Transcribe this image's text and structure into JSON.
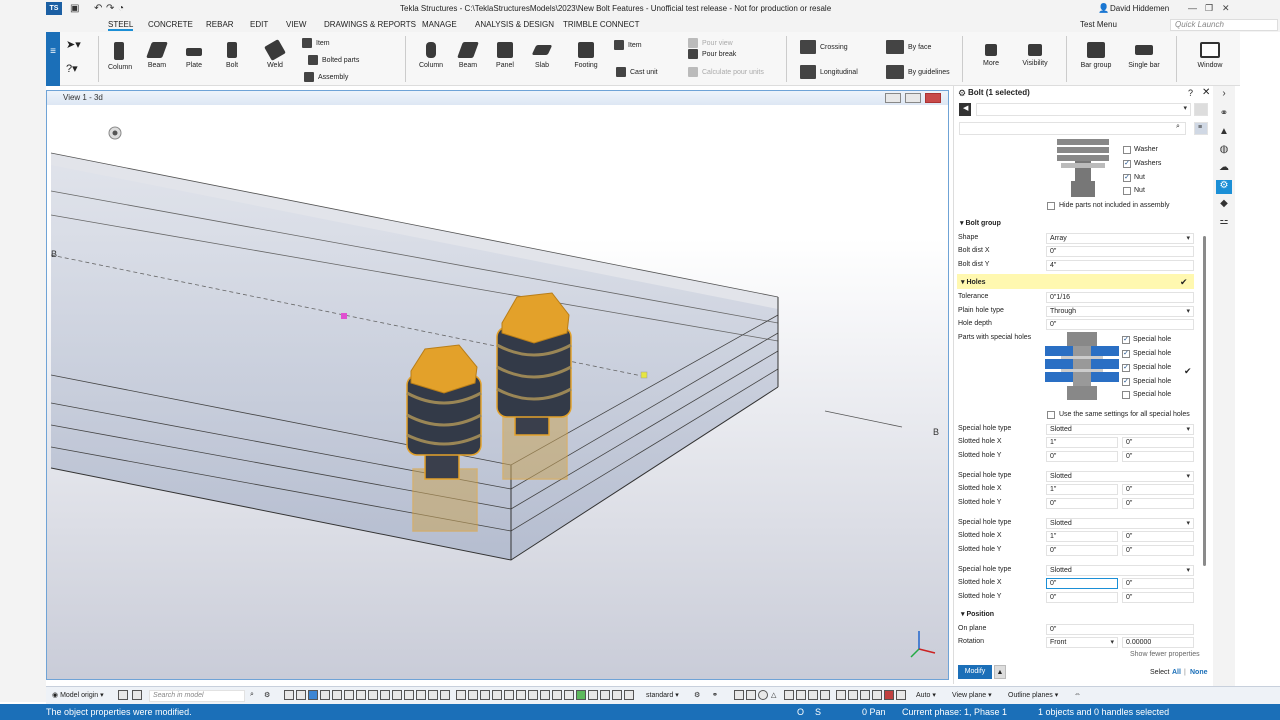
{
  "title_bar": {
    "app_logo": "TS",
    "title": "Tekla Structures - C:\\TeklaStructuresModels\\2023\\New Bolt Features - Unofficial test release - Not for production or resale",
    "user": "David Hiddemen"
  },
  "menu": {
    "tabs": [
      "STEEL",
      "CONCRETE",
      "REBAR",
      "EDIT",
      "VIEW",
      "DRAWINGS & REPORTS",
      "MANAGE",
      "ANALYSIS & DESIGN",
      "TRIMBLE CONNECT"
    ],
    "active": "STEEL",
    "test_menu": "Test Menu",
    "quick_launch_placeholder": "Quick Launch"
  },
  "ribbon": {
    "steel": [
      "Column",
      "Beam",
      "Plate",
      "Bolt",
      "Weld"
    ],
    "steel_small": [
      "Item",
      "Bolted parts",
      "Assembly"
    ],
    "concrete": [
      "Column",
      "Beam",
      "Panel",
      "Slab",
      "Footing"
    ],
    "concrete_small": [
      "Item",
      "Cast unit"
    ],
    "pour": [
      "Pour view",
      "Pour break",
      "Calculate pour units"
    ],
    "rebar": [
      "Crossing",
      "Longitudinal"
    ],
    "rebar_by": [
      "By face",
      "By guidelines"
    ],
    "tools": [
      "More",
      "Visibility"
    ],
    "bar": [
      "Bar group",
      "Single bar"
    ],
    "window": "Window"
  },
  "view": {
    "title": "View 1 - 3d",
    "gridlabel_left": "B",
    "gridlabel_right": "B"
  },
  "panel": {
    "title": "Bolt (1 selected)",
    "assembly_checks": [
      {
        "label": "Washer",
        "checked": false
      },
      {
        "label": "Washers",
        "checked": true
      },
      {
        "label": "Nut",
        "checked": true
      },
      {
        "label": "Nut",
        "checked": false
      }
    ],
    "hide_parts_label": "Hide parts not included in assembly",
    "bolt_group": {
      "header": "Bolt group",
      "shape_label": "Shape",
      "shape": "Array",
      "dist_x_label": "Bolt dist X",
      "dist_x": "0\"",
      "dist_y_label": "Bolt dist Y",
      "dist_y": "4\""
    },
    "holes": {
      "header": "Holes",
      "tolerance_label": "Tolerance",
      "tolerance": "0\"1/16",
      "plain_label": "Plain hole type",
      "plain": "Through",
      "depth_label": "Hole depth",
      "depth": "0\"",
      "parts_label": "Parts with special holes",
      "special": [
        {
          "label": "Special hole",
          "checked": true
        },
        {
          "label": "Special hole",
          "checked": true
        },
        {
          "label": "Special hole",
          "checked": true
        },
        {
          "label": "Special hole",
          "checked": true
        },
        {
          "label": "Special hole",
          "checked": false
        }
      ],
      "same_settings_label": "Use the same settings for all special holes",
      "groups": [
        {
          "type_label": "Special hole type",
          "type": "Slotted",
          "x_label": "Slotted hole X",
          "x1": "1\"",
          "x2": "0\"",
          "y_label": "Slotted hole Y",
          "y1": "0\"",
          "y2": "0\""
        },
        {
          "type_label": "Special hole type",
          "type": "Slotted",
          "x_label": "Slotted hole X",
          "x1": "1\"",
          "x2": "0\"",
          "y_label": "Slotted hole Y",
          "y1": "0\"",
          "y2": "0\""
        },
        {
          "type_label": "Special hole type",
          "type": "Slotted",
          "x_label": "Slotted hole X",
          "x1": "1\"",
          "x2": "0\"",
          "y_label": "Slotted hole Y",
          "y1": "0\"",
          "y2": "0\""
        },
        {
          "type_label": "Special hole type",
          "type": "Slotted",
          "x_label": "Slotted hole X",
          "x1": "0\"",
          "x2": "0\"",
          "y_label": "Slotted hole Y",
          "y1": "0\"",
          "y2": "0\""
        }
      ]
    },
    "position": {
      "header": "Position",
      "plane_label": "On plane",
      "plane": "0\"",
      "rotation_label": "Rotation",
      "rotation": "Front",
      "rotation_val": "0.00000"
    },
    "show_fewer": "Show fewer properties",
    "modify": "Modify",
    "select_label": "Select",
    "select_all": "All",
    "select_none": "None"
  },
  "bottom": {
    "model_origin": "Model origin",
    "search_placeholder": "Search in model",
    "standard": "standard",
    "auto": "Auto",
    "view_plane": "View plane",
    "outline_planes": "Outline planes"
  },
  "status": {
    "message": "The object properties were modified.",
    "o": "O",
    "s": "S",
    "pan": "0  Pan",
    "phase": "Current phase: 1, Phase 1",
    "selected": "1 objects and 0 handles selected"
  },
  "colors": {
    "accent": "#1b6fb8",
    "highlight": "#fff8b0",
    "bolt_gold": "#e3a12a"
  }
}
